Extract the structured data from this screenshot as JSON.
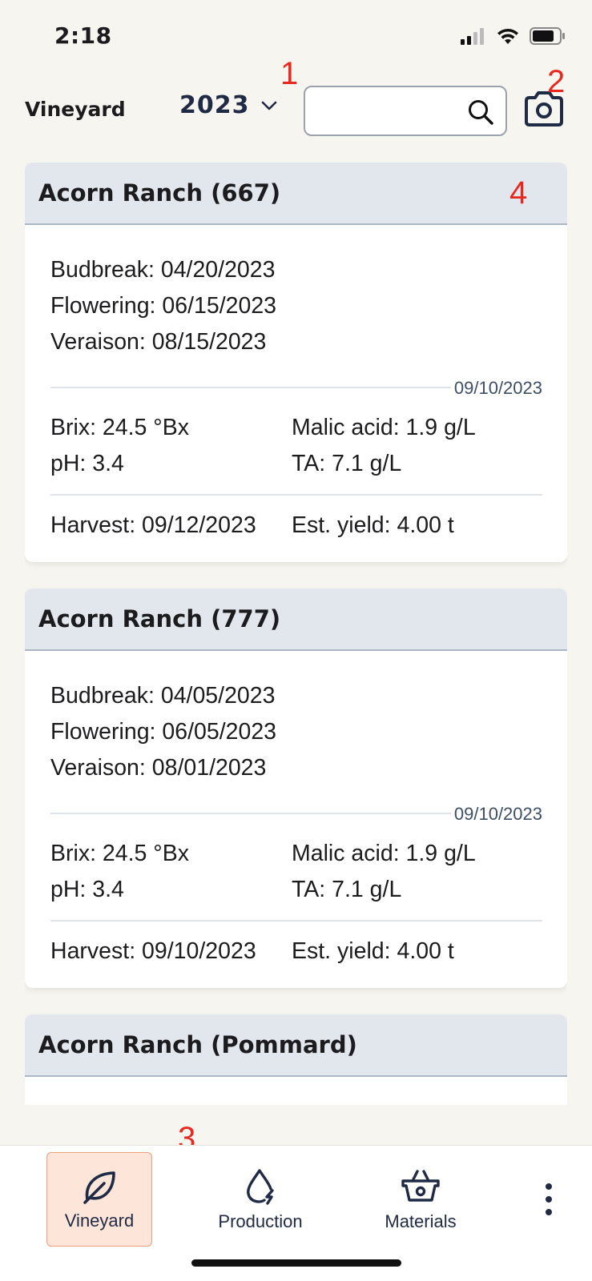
{
  "status_bar": {
    "time": "2:18"
  },
  "header": {
    "title": "Vineyard",
    "year": "2023",
    "search": {
      "value": "",
      "placeholder": ""
    }
  },
  "annotations": [
    "1",
    "2",
    "3",
    "4"
  ],
  "cards": [
    {
      "title": "Acorn Ranch (667)",
      "budbreak": "Budbreak: 04/20/2023",
      "flowering": "Flowering: 06/15/2023",
      "veraison": "Veraison: 08/15/2023",
      "sample_date": "09/10/2023",
      "brix": "Brix: 24.5 °Bx",
      "malic": "Malic acid: 1.9 g/L",
      "ph": "pH: 3.4",
      "ta": "TA: 7.1 g/L",
      "harvest": "Harvest: 09/12/2023",
      "yield": "Est. yield: 4.00 t"
    },
    {
      "title": "Acorn Ranch (777)",
      "budbreak": "Budbreak: 04/05/2023",
      "flowering": "Flowering: 06/05/2023",
      "veraison": "Veraison: 08/01/2023",
      "sample_date": "09/10/2023",
      "brix": "Brix: 24.5 °Bx",
      "malic": "Malic acid: 1.9 g/L",
      "ph": "pH: 3.4",
      "ta": "TA: 7.1 g/L",
      "harvest": "Harvest: 09/10/2023",
      "yield": "Est. yield: 4.00 t"
    },
    {
      "title": "Acorn Ranch (Pommard)"
    }
  ],
  "nav": {
    "vineyard": "Vineyard",
    "production": "Production",
    "materials": "Materials"
  },
  "colors": {
    "background": "#f7f5ef",
    "card_header": "#e2e7ee",
    "accent_active": "#fde5d9",
    "annotation": "#e8281e"
  },
  "icons": [
    "signal-icon",
    "wifi-icon",
    "battery-icon",
    "chevron-down-icon",
    "search-icon",
    "camera-icon",
    "leaf-icon",
    "drop-bolt-icon",
    "basket-icon",
    "more-vertical-icon"
  ]
}
